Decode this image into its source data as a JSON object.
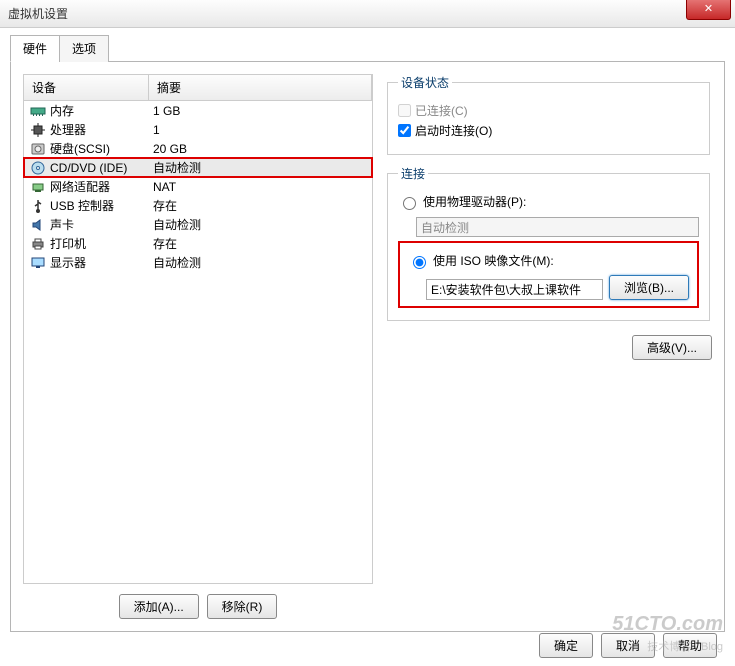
{
  "window": {
    "title": "虚拟机设置"
  },
  "tabs": {
    "hardware": "硬件",
    "options": "选项"
  },
  "list": {
    "header_device": "设备",
    "header_summary": "摘要",
    "rows": [
      {
        "device": "内存",
        "summary": "1 GB"
      },
      {
        "device": "处理器",
        "summary": "1"
      },
      {
        "device": "硬盘(SCSI)",
        "summary": "20 GB"
      },
      {
        "device": "CD/DVD (IDE)",
        "summary": "自动检测"
      },
      {
        "device": "网络适配器",
        "summary": "NAT"
      },
      {
        "device": "USB 控制器",
        "summary": "存在"
      },
      {
        "device": "声卡",
        "summary": "自动检测"
      },
      {
        "device": "打印机",
        "summary": "存在"
      },
      {
        "device": "显示器",
        "summary": "自动检测"
      }
    ]
  },
  "buttons": {
    "add": "添加(A)...",
    "remove": "移除(R)",
    "browse": "浏览(B)...",
    "advanced": "高级(V)...",
    "ok": "确定",
    "cancel": "取消",
    "help": "帮助"
  },
  "status": {
    "legend": "设备状态",
    "connected": "已连接(C)",
    "connect_poweron": "启动时连接(O)"
  },
  "connection": {
    "legend": "连接",
    "physical": "使用物理驱动器(P):",
    "physical_value": "自动检测",
    "iso": "使用 ISO 映像文件(M):",
    "iso_value": "E:\\安装软件包\\大叔上课软件"
  },
  "watermark": {
    "main": "51CTO.com",
    "sub": "技术博客 · Blog"
  }
}
